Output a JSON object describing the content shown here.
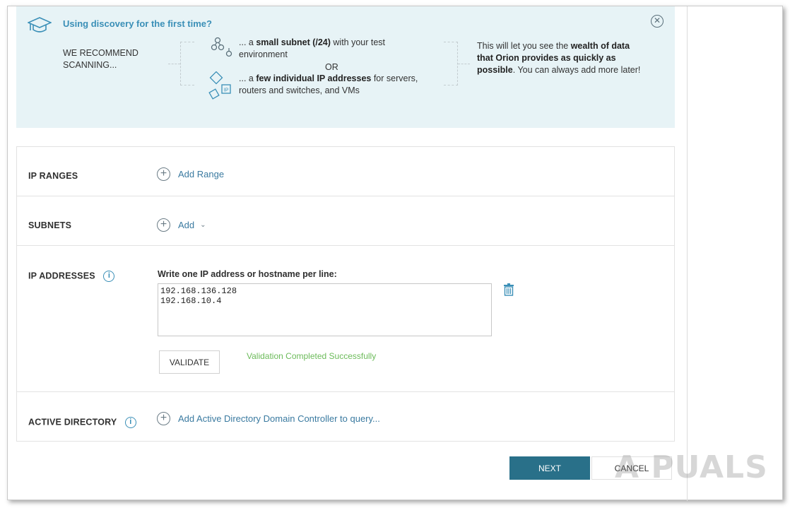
{
  "banner": {
    "title": "Using discovery for the first time?",
    "recommend": "WE RECOMMEND SCANNING...",
    "option1_prefix": "... a ",
    "option1_bold": "small subnet (/24)",
    "option1_suffix": " with your test environment",
    "or": "OR",
    "option2_prefix": "... a ",
    "option2_bold": "few individual IP addresses",
    "option2_suffix": " for servers, routers and switches, and VMs",
    "wealth_prefix": "This will let you see the ",
    "wealth_bold": "wealth of data that Orion provides as quickly as possible",
    "wealth_suffix": ". You can always add more later!",
    "ip_badge": "IP"
  },
  "sections": {
    "ip_ranges": {
      "label": "IP RANGES",
      "add_label": "Add Range"
    },
    "subnets": {
      "label": "SUBNETS",
      "add_label": "Add"
    },
    "ip_addresses": {
      "label": "IP ADDRESSES",
      "caption": "Write one IP address or hostname per line:",
      "value": "192.168.136.128\n192.168.10.4",
      "validate_label": "VALIDATE",
      "validation_message": "Validation Completed Successfully"
    },
    "active_directory": {
      "label": "ACTIVE DIRECTORY",
      "add_label": "Add Active Directory Domain Controller to query..."
    }
  },
  "footer": {
    "next_label": "NEXT",
    "cancel_label": "CANCEL"
  },
  "watermark": "A PUALS",
  "colors": {
    "accent": "#3a8fb7",
    "primary_button": "#297089",
    "banner_bg": "#e7f3f6",
    "success": "#6cbb5a"
  },
  "icons": [
    "graduation-cap-icon",
    "close-icon",
    "subnet-icon",
    "ip-address-icon",
    "plus-circle-icon",
    "chevron-down-icon",
    "info-icon",
    "trash-icon"
  ]
}
